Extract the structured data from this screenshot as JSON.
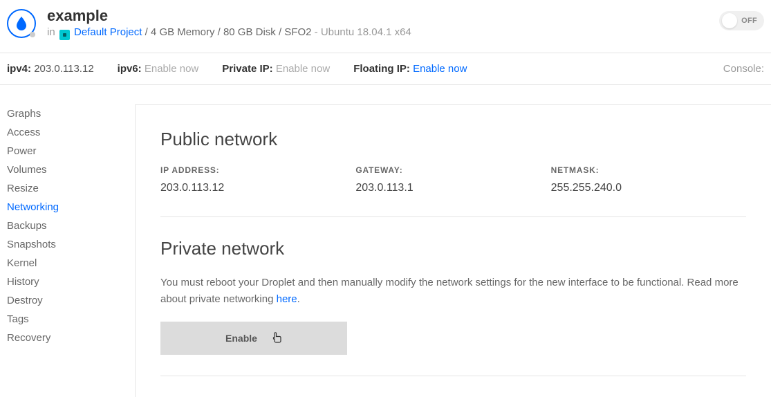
{
  "header": {
    "title": "example",
    "in_label": "in",
    "project_link": "Default Project",
    "specs": "/ 4 GB Memory / 80 GB Disk / SFO2",
    "os": "- Ubuntu 18.04.1 x64",
    "toggle_label": "OFF"
  },
  "info_bar": {
    "ipv4_label": "ipv4:",
    "ipv4_value": "203.0.113.12",
    "ipv6_label": "ipv6:",
    "ipv6_action": "Enable now",
    "private_label": "Private IP:",
    "private_action": "Enable now",
    "floating_label": "Floating IP:",
    "floating_action": "Enable now",
    "console": "Console:"
  },
  "sidebar": {
    "items": [
      {
        "label": "Graphs",
        "active": false
      },
      {
        "label": "Access",
        "active": false
      },
      {
        "label": "Power",
        "active": false
      },
      {
        "label": "Volumes",
        "active": false
      },
      {
        "label": "Resize",
        "active": false
      },
      {
        "label": "Networking",
        "active": true
      },
      {
        "label": "Backups",
        "active": false
      },
      {
        "label": "Snapshots",
        "active": false
      },
      {
        "label": "Kernel",
        "active": false
      },
      {
        "label": "History",
        "active": false
      },
      {
        "label": "Destroy",
        "active": false
      },
      {
        "label": "Tags",
        "active": false
      },
      {
        "label": "Recovery",
        "active": false
      }
    ]
  },
  "public_network": {
    "heading": "Public network",
    "ip_label": "IP ADDRESS:",
    "ip_value": "203.0.113.12",
    "gateway_label": "GATEWAY:",
    "gateway_value": "203.0.113.1",
    "netmask_label": "NETMASK:",
    "netmask_value": "255.255.240.0"
  },
  "private_network": {
    "heading": "Private network",
    "desc_1": "You must reboot your Droplet and then manually modify the network settings for the new interface to be functional. Read more about private networking ",
    "desc_link": "here",
    "desc_2": ".",
    "button": "Enable"
  }
}
